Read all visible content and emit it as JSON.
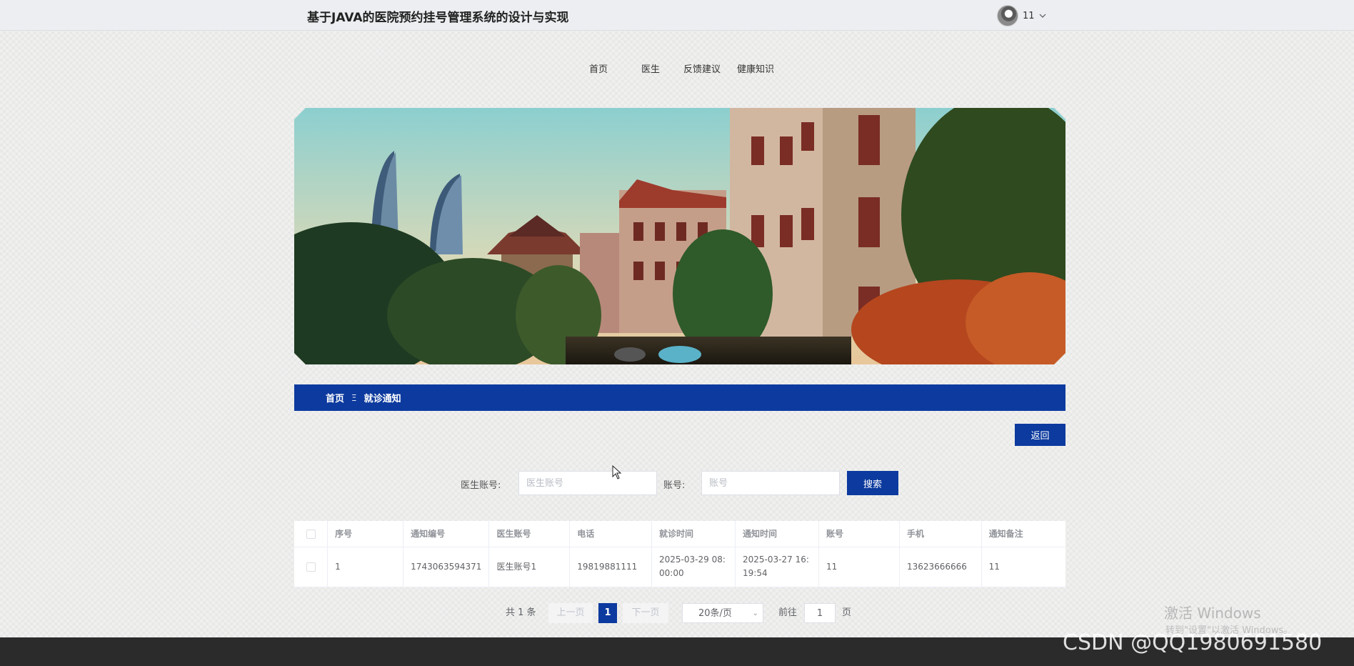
{
  "header": {
    "site_title": "基于JAVA的医院预约挂号管理系统的设计与实现",
    "user_name": "11"
  },
  "nav": {
    "items": [
      "首页",
      "医生",
      "反馈建议",
      "健康知识"
    ]
  },
  "breadcrumb": {
    "home": "首页",
    "separator": "Ξ",
    "current": "就诊通知"
  },
  "actions": {
    "return_label": "返回"
  },
  "search": {
    "doctor_account_label": "医生账号:",
    "doctor_account_placeholder": "医生账号",
    "account_label": "账号:",
    "account_placeholder": "账号",
    "search_label": "搜索"
  },
  "table": {
    "headers": [
      "序号",
      "通知编号",
      "医生账号",
      "电话",
      "就诊时间",
      "通知时间",
      "账号",
      "手机",
      "通知备注"
    ],
    "rows": [
      {
        "index": "1",
        "notice_no": "1743063594371",
        "doctor_account": "医生账号1",
        "phone": "19819881111",
        "visit_time": "2025-03-29 08:00:00",
        "notice_time": "2025-03-27 16:19:54",
        "account": "11",
        "mobile": "13623666666",
        "remark": "11"
      }
    ]
  },
  "pagination": {
    "total": "共 1 条",
    "prev": "上一页",
    "current_page": "1",
    "next": "下一页",
    "page_size": "20条/页",
    "goto_label": "前往",
    "goto_value": "1",
    "page_suffix": "页"
  },
  "watermarks": {
    "windows_title": "激活 Windows",
    "windows_sub": "转到\"设置\"以激活 Windows。",
    "csdn": "CSDN @QQ1980691580"
  },
  "colors": {
    "primary": "#0c3a9e",
    "footer": "#2b2b2b"
  }
}
